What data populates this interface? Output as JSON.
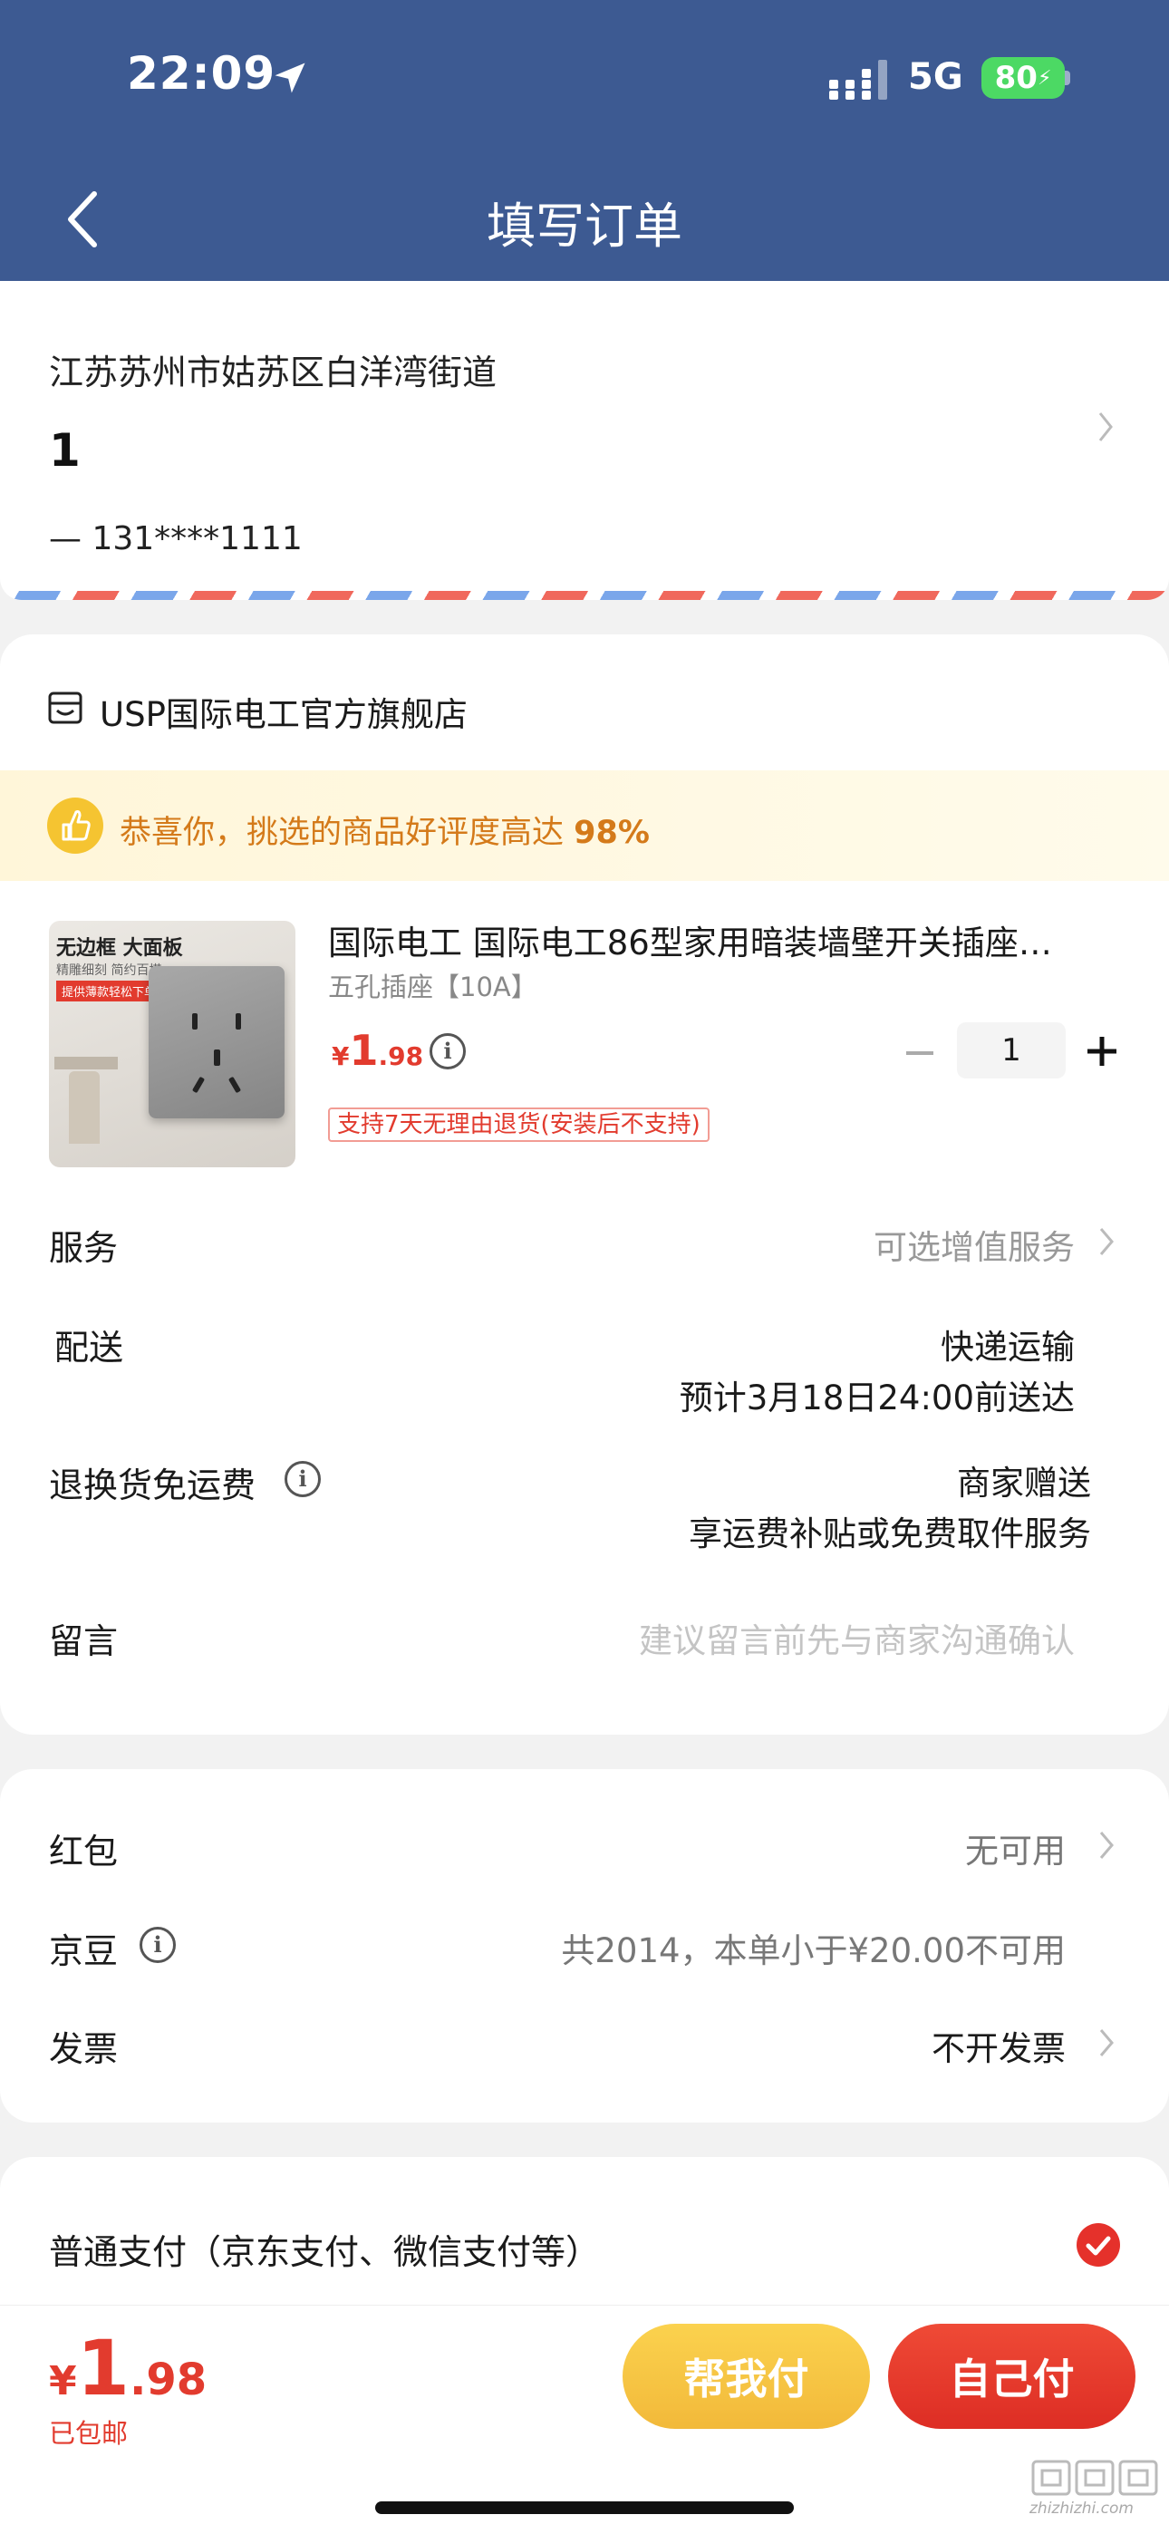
{
  "status_bar": {
    "time": "22:09",
    "network": "5G",
    "battery": "80"
  },
  "nav": {
    "title": "填写订单"
  },
  "address": {
    "line": "江苏苏州市姑苏区白洋湾街道",
    "name": "1",
    "phone": "—  131****1111"
  },
  "shop": {
    "name": "USP国际电工官方旗舰店"
  },
  "praise": {
    "text": "恭喜你，挑选的商品好评度高达",
    "percent": "98%"
  },
  "product": {
    "title": "国际电工 国际电工86型家用暗装墙壁开关插座…",
    "sku": "五孔插座【10A】",
    "price_symbol": "¥",
    "price_int": "1",
    "price_dec": ".98",
    "quantity": "1",
    "return_tag": "支持7天无理由退货(安装后不支持)",
    "image_tags": [
      "无边框 大面板",
      "精雕细刻 简约百搭",
      "提供薄款轻松下单"
    ]
  },
  "rows": {
    "service": {
      "label": "服务",
      "value": "可选增值服务"
    },
    "delivery": {
      "label": "配送",
      "value": "快递运输",
      "eta": "预计3月18日24:00前送达"
    },
    "return_shipping": {
      "label": "退换货免运费",
      "value": "商家赠送",
      "sub": "享运费补贴或免费取件服务"
    },
    "message": {
      "label": "留言",
      "placeholder": "建议留言前先与商家沟通确认"
    }
  },
  "coupons": {
    "red_packet": {
      "label": "红包",
      "value": "无可用"
    },
    "jingdou": {
      "label": "京豆",
      "value": "共2014，本单小于¥20.00不可用"
    },
    "invoice": {
      "label": "发票",
      "value": "不开发票"
    }
  },
  "payment": {
    "method": "普通支付（京东支付、微信支付等）"
  },
  "footer": {
    "total_symbol": "¥",
    "total_int": "1",
    "total_dec": ".98",
    "shipping_note": "已包邮",
    "help_pay": "帮我付",
    "self_pay": "自己付"
  },
  "watermark": {
    "url": "zhizhizhi.com"
  },
  "colors": {
    "header": "#3d5a92",
    "accent": "#e23b2e",
    "help_btn": "#f5c431",
    "praise_text": "#d47a1a"
  },
  "icons": [
    "location-arrow-icon",
    "signal-icon",
    "back-chevron-icon",
    "chevron-right-icon",
    "shop-icon",
    "thumbs-up-icon",
    "info-icon",
    "minus-icon",
    "plus-icon",
    "check-icon"
  ]
}
